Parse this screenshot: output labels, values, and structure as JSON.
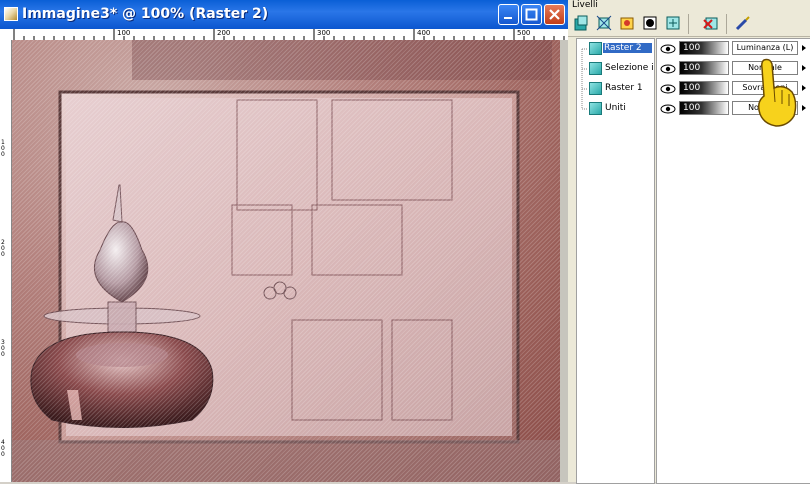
{
  "window": {
    "title": "Immagine3* @ 100% (Raster 2)",
    "buttons": [
      "minimize",
      "maximize",
      "close"
    ]
  },
  "ruler": {
    "horizontal_ticks": [
      "100",
      "200",
      "300",
      "400",
      "500"
    ],
    "vertical_ticks": [
      "100",
      "200",
      "300",
      "400"
    ]
  },
  "layers_panel": {
    "title": "Livelli",
    "toolbar_icons": [
      "new-raster-layer-icon",
      "new-vector-layer-icon",
      "new-adjustment-layer-icon",
      "new-mask-icon",
      "layer-properties-icon",
      "delete-layer-icon",
      "paint-tool-icon"
    ],
    "layers": [
      {
        "name": "Raster 2",
        "opacity": "100",
        "blend": "Luminanza (L)",
        "selected": true
      },
      {
        "name": "Selezione in",
        "opacity": "100",
        "blend": "Normale",
        "selected": false
      },
      {
        "name": "Raster 1",
        "opacity": "100",
        "blend": "Sovrapponi",
        "selected": false
      },
      {
        "name": "Uniti",
        "opacity": "100",
        "blend": "Normale",
        "selected": false
      }
    ]
  },
  "colors": {
    "title_bar": "#0a5fd6",
    "selection": "#316ac5",
    "canvas_base": "#b4827e"
  }
}
